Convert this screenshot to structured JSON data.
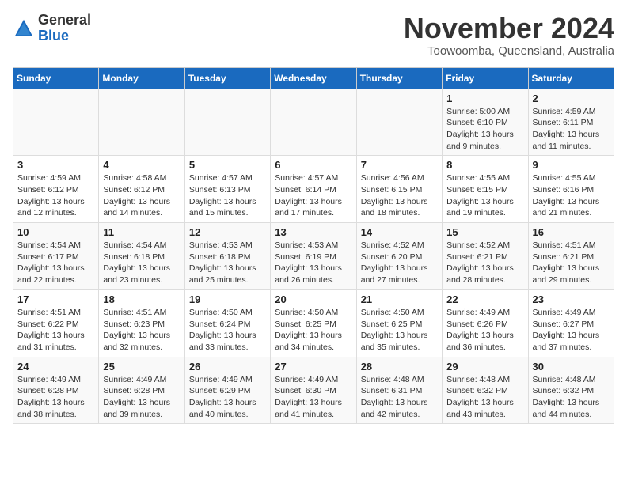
{
  "header": {
    "logo_general": "General",
    "logo_blue": "Blue",
    "month_title": "November 2024",
    "location": "Toowoomba, Queensland, Australia"
  },
  "weekdays": [
    "Sunday",
    "Monday",
    "Tuesday",
    "Wednesday",
    "Thursday",
    "Friday",
    "Saturday"
  ],
  "weeks": [
    [
      {
        "day": "",
        "info": ""
      },
      {
        "day": "",
        "info": ""
      },
      {
        "day": "",
        "info": ""
      },
      {
        "day": "",
        "info": ""
      },
      {
        "day": "",
        "info": ""
      },
      {
        "day": "1",
        "info": "Sunrise: 5:00 AM\nSunset: 6:10 PM\nDaylight: 13 hours\nand 9 minutes."
      },
      {
        "day": "2",
        "info": "Sunrise: 4:59 AM\nSunset: 6:11 PM\nDaylight: 13 hours\nand 11 minutes."
      }
    ],
    [
      {
        "day": "3",
        "info": "Sunrise: 4:59 AM\nSunset: 6:12 PM\nDaylight: 13 hours\nand 12 minutes."
      },
      {
        "day": "4",
        "info": "Sunrise: 4:58 AM\nSunset: 6:12 PM\nDaylight: 13 hours\nand 14 minutes."
      },
      {
        "day": "5",
        "info": "Sunrise: 4:57 AM\nSunset: 6:13 PM\nDaylight: 13 hours\nand 15 minutes."
      },
      {
        "day": "6",
        "info": "Sunrise: 4:57 AM\nSunset: 6:14 PM\nDaylight: 13 hours\nand 17 minutes."
      },
      {
        "day": "7",
        "info": "Sunrise: 4:56 AM\nSunset: 6:15 PM\nDaylight: 13 hours\nand 18 minutes."
      },
      {
        "day": "8",
        "info": "Sunrise: 4:55 AM\nSunset: 6:15 PM\nDaylight: 13 hours\nand 19 minutes."
      },
      {
        "day": "9",
        "info": "Sunrise: 4:55 AM\nSunset: 6:16 PM\nDaylight: 13 hours\nand 21 minutes."
      }
    ],
    [
      {
        "day": "10",
        "info": "Sunrise: 4:54 AM\nSunset: 6:17 PM\nDaylight: 13 hours\nand 22 minutes."
      },
      {
        "day": "11",
        "info": "Sunrise: 4:54 AM\nSunset: 6:18 PM\nDaylight: 13 hours\nand 23 minutes."
      },
      {
        "day": "12",
        "info": "Sunrise: 4:53 AM\nSunset: 6:18 PM\nDaylight: 13 hours\nand 25 minutes."
      },
      {
        "day": "13",
        "info": "Sunrise: 4:53 AM\nSunset: 6:19 PM\nDaylight: 13 hours\nand 26 minutes."
      },
      {
        "day": "14",
        "info": "Sunrise: 4:52 AM\nSunset: 6:20 PM\nDaylight: 13 hours\nand 27 minutes."
      },
      {
        "day": "15",
        "info": "Sunrise: 4:52 AM\nSunset: 6:21 PM\nDaylight: 13 hours\nand 28 minutes."
      },
      {
        "day": "16",
        "info": "Sunrise: 4:51 AM\nSunset: 6:21 PM\nDaylight: 13 hours\nand 29 minutes."
      }
    ],
    [
      {
        "day": "17",
        "info": "Sunrise: 4:51 AM\nSunset: 6:22 PM\nDaylight: 13 hours\nand 31 minutes."
      },
      {
        "day": "18",
        "info": "Sunrise: 4:51 AM\nSunset: 6:23 PM\nDaylight: 13 hours\nand 32 minutes."
      },
      {
        "day": "19",
        "info": "Sunrise: 4:50 AM\nSunset: 6:24 PM\nDaylight: 13 hours\nand 33 minutes."
      },
      {
        "day": "20",
        "info": "Sunrise: 4:50 AM\nSunset: 6:25 PM\nDaylight: 13 hours\nand 34 minutes."
      },
      {
        "day": "21",
        "info": "Sunrise: 4:50 AM\nSunset: 6:25 PM\nDaylight: 13 hours\nand 35 minutes."
      },
      {
        "day": "22",
        "info": "Sunrise: 4:49 AM\nSunset: 6:26 PM\nDaylight: 13 hours\nand 36 minutes."
      },
      {
        "day": "23",
        "info": "Sunrise: 4:49 AM\nSunset: 6:27 PM\nDaylight: 13 hours\nand 37 minutes."
      }
    ],
    [
      {
        "day": "24",
        "info": "Sunrise: 4:49 AM\nSunset: 6:28 PM\nDaylight: 13 hours\nand 38 minutes."
      },
      {
        "day": "25",
        "info": "Sunrise: 4:49 AM\nSunset: 6:28 PM\nDaylight: 13 hours\nand 39 minutes."
      },
      {
        "day": "26",
        "info": "Sunrise: 4:49 AM\nSunset: 6:29 PM\nDaylight: 13 hours\nand 40 minutes."
      },
      {
        "day": "27",
        "info": "Sunrise: 4:49 AM\nSunset: 6:30 PM\nDaylight: 13 hours\nand 41 minutes."
      },
      {
        "day": "28",
        "info": "Sunrise: 4:48 AM\nSunset: 6:31 PM\nDaylight: 13 hours\nand 42 minutes."
      },
      {
        "day": "29",
        "info": "Sunrise: 4:48 AM\nSunset: 6:32 PM\nDaylight: 13 hours\nand 43 minutes."
      },
      {
        "day": "30",
        "info": "Sunrise: 4:48 AM\nSunset: 6:32 PM\nDaylight: 13 hours\nand 44 minutes."
      }
    ]
  ]
}
